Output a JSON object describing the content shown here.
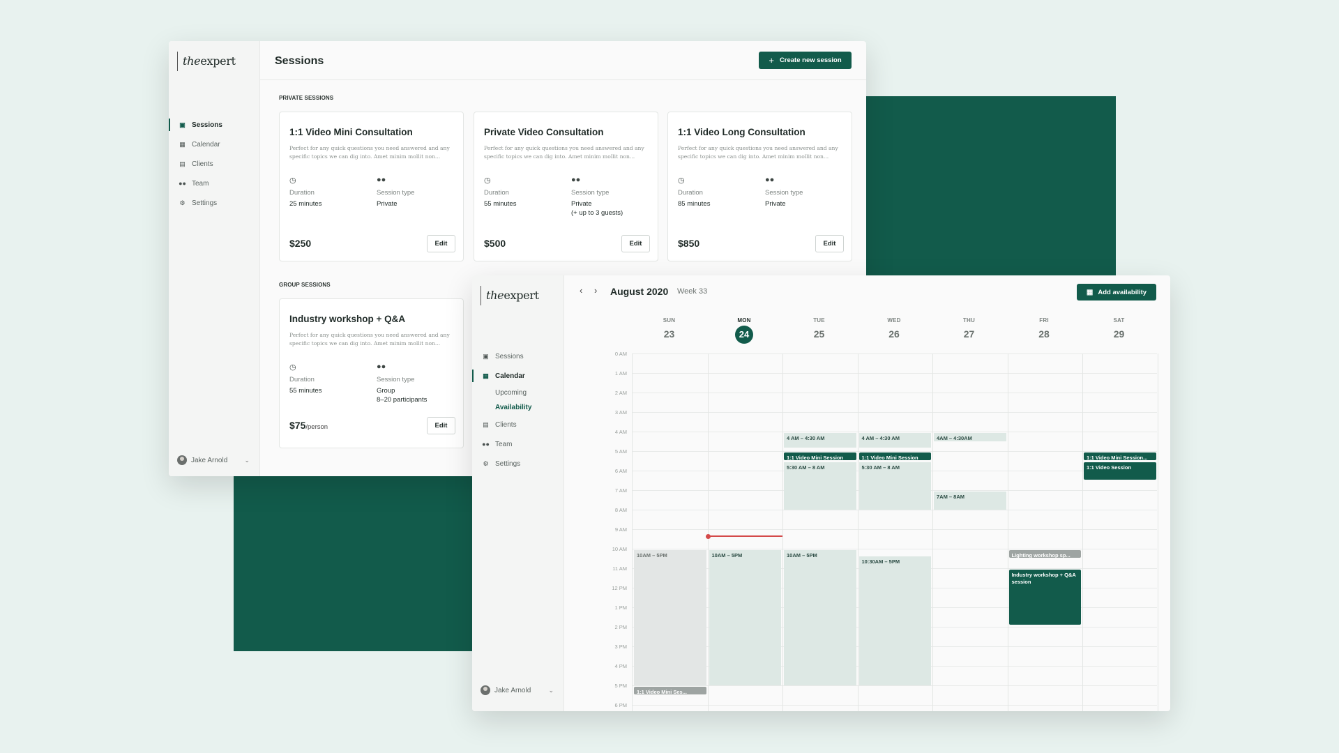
{
  "colors": {
    "brand": "#125b4b",
    "background": "#e8f2ef",
    "now_indicator": "#d44a4a"
  },
  "sessions_window": {
    "logo": {
      "prefix": "the",
      "suffix": "expert"
    },
    "nav": [
      {
        "label": "Sessions",
        "icon": "sessions-icon",
        "active": true
      },
      {
        "label": "Calendar",
        "icon": "calendar-icon",
        "active": false
      },
      {
        "label": "Clients",
        "icon": "clients-icon",
        "active": false
      },
      {
        "label": "Team",
        "icon": "team-icon",
        "active": false
      },
      {
        "label": "Settings",
        "icon": "gear-icon",
        "active": false
      }
    ],
    "user": {
      "name": "Jake Arnold"
    },
    "title": "Sessions",
    "create_button": "Create new session",
    "private_label": "PRIVATE SESSIONS",
    "group_label": "GROUP SESSIONS",
    "cards": [
      {
        "title": "1:1 Video Mini Consultation",
        "desc": "Perfect for any quick questions you need answered and any specific topics we can dig into. Amet minim mollit non...",
        "duration_label": "Duration",
        "duration": "25 minutes",
        "type_label": "Session type",
        "type": "Private",
        "type_extra": "",
        "price": "$250",
        "price_unit": "",
        "edit": "Edit"
      },
      {
        "title": "Private Video Consultation",
        "desc": "Perfect for any quick questions you need answered and any specific topics we can dig into. Amet minim mollit non...",
        "duration_label": "Duration",
        "duration": "55 minutes",
        "type_label": "Session type",
        "type": "Private",
        "type_extra": "(+ up to 3 guests)",
        "price": "$500",
        "price_unit": "",
        "edit": "Edit"
      },
      {
        "title": "1:1 Video Long Consultation",
        "desc": "Perfect for any quick questions you need answered and any specific topics we can dig into. Amet minim mollit non...",
        "duration_label": "Duration",
        "duration": "85 minutes",
        "type_label": "Session type",
        "type": "Private",
        "type_extra": "",
        "price": "$850",
        "price_unit": "",
        "edit": "Edit"
      },
      {
        "title": "Industry workshop + Q&A",
        "desc": "Perfect for any quick questions you need answered and any specific topics we can dig into. Amet minim mollit non...",
        "duration_label": "Duration",
        "duration": "55 minutes",
        "type_label": "Session type",
        "type": "Group",
        "type_extra": "8–20 participants",
        "price": "$75",
        "price_unit": "/person",
        "edit": "Edit"
      }
    ]
  },
  "calendar_window": {
    "logo": {
      "prefix": "the",
      "suffix": "expert"
    },
    "nav": {
      "sessions": "Sessions",
      "calendar": "Calendar",
      "upcoming": "Upcoming",
      "availability": "Availability",
      "clients": "Clients",
      "team": "Team",
      "settings": "Settings"
    },
    "user": {
      "name": "Jake Arnold"
    },
    "month": "August 2020",
    "week": "Week 33",
    "prev": "‹",
    "next": "›",
    "add_button": "Add availability",
    "days": [
      {
        "name": "SUN",
        "date": "23",
        "today": false
      },
      {
        "name": "MON",
        "date": "24",
        "today": true
      },
      {
        "name": "TUE",
        "date": "25",
        "today": false
      },
      {
        "name": "WED",
        "date": "26",
        "today": false
      },
      {
        "name": "THU",
        "date": "27",
        "today": false
      },
      {
        "name": "FRI",
        "date": "28",
        "today": false
      },
      {
        "name": "SAT",
        "date": "29",
        "today": false
      }
    ],
    "hours": [
      "0 AM",
      "1 AM",
      "2 AM",
      "3 AM",
      "4 AM",
      "5 AM",
      "6 AM",
      "7 AM",
      "8 AM",
      "9 AM",
      "10 AM",
      "11 AM",
      "12 PM",
      "1 PM",
      "2 PM",
      "3 PM",
      "4 PM",
      "5 PM",
      "6 PM"
    ],
    "now_time": 9.33,
    "events": [
      {
        "day": 0,
        "start": 10,
        "end": 17,
        "label": "10AM – 5PM",
        "style": "grey"
      },
      {
        "day": 1,
        "start": 10,
        "end": 17,
        "label": "10AM – 5PM",
        "style": "pale"
      },
      {
        "day": 2,
        "start": 10,
        "end": 17,
        "label": "10AM – 5PM",
        "style": "pale"
      },
      {
        "day": 3,
        "start": 10.33,
        "end": 17,
        "label": "10:30AM – 5PM",
        "style": "pale"
      },
      {
        "day": 2,
        "start": 4,
        "end": 4.83,
        "label": "4 AM – 4:30 AM",
        "style": "pale"
      },
      {
        "day": 3,
        "start": 4,
        "end": 4.83,
        "label": "4 AM – 4:30 AM",
        "style": "pale"
      },
      {
        "day": 4,
        "start": 4,
        "end": 4.5,
        "label": "4AM – 4:30AM",
        "style": "pale"
      },
      {
        "day": 2,
        "start": 5,
        "end": 5.45,
        "label": "1:1 Video Mini Session",
        "style": "dark"
      },
      {
        "day": 3,
        "start": 5,
        "end": 5.45,
        "label": "1:1 Video Mini Session",
        "style": "dark"
      },
      {
        "day": 2,
        "start": 5.5,
        "end": 8,
        "label": "5:30 AM – 8 AM",
        "style": "pale"
      },
      {
        "day": 3,
        "start": 5.5,
        "end": 8,
        "label": "5:30 AM – 8 AM",
        "style": "pale"
      },
      {
        "day": 4,
        "start": 7,
        "end": 8,
        "label": "7AM – 8AM",
        "style": "pale"
      },
      {
        "day": 6,
        "start": 5,
        "end": 5.45,
        "label": "1:1 Video Mini Session...",
        "style": "dark"
      },
      {
        "day": 6,
        "start": 5.5,
        "end": 6.45,
        "label": "1:1 Video Session",
        "style": "dark"
      },
      {
        "day": 5,
        "start": 10,
        "end": 10.45,
        "label": "Lighting workshop sp...",
        "style": "dgrey"
      },
      {
        "day": 5,
        "start": 11,
        "end": 13.9,
        "label": "Industry workshop + Q&A session",
        "style": "dark",
        "wrap": true
      },
      {
        "day": 0,
        "start": 17,
        "end": 17.45,
        "label": "1:1 Video Mini Ses...",
        "style": "dgrey"
      }
    ]
  }
}
